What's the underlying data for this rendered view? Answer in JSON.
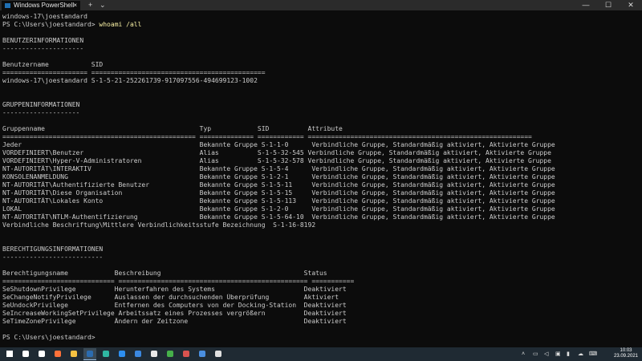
{
  "window": {
    "tab_title": "Windows PowerShell",
    "tab_close": "×",
    "new_tab": "+",
    "tab_dropdown": "⌄",
    "minimize": "—",
    "maximize": "☐",
    "close": "✕"
  },
  "terminal": {
    "lines": [
      "windows-17\\joestandard",
      "PS C:\\Users\\joestandard> ",
      "",
      "BENUTZERINFORMATIONEN",
      "---------------------",
      "",
      "Benutzername           SID",
      "====================== =============================================",
      "windows-17\\joestandard S-1-5-21-252261739-917097556-494699123-1002",
      "",
      "",
      "GRUPPENINFORMATIONEN",
      "--------------------",
      "",
      "Gruppenname                                        Typ            SID          Attribute",
      "================================================== ============== ============ ==========================================================",
      "Jeder                                              Bekannte Gruppe S-1-1-0      Verbindliche Gruppe, Standardmäßig aktiviert, Aktivierte Gruppe",
      "VORDEFINIERT\\Benutzer                              Alias          S-1-5-32-545 Verbindliche Gruppe, Standardmäßig aktiviert, Aktivierte Gruppe",
      "VORDEFINIERT\\Hyper-V-Administratoren               Alias          S-1-5-32-578 Verbindliche Gruppe, Standardmäßig aktiviert, Aktivierte Gruppe",
      "NT-AUTORITÄT\\INTERAKTIV                            Bekannte Gruppe S-1-5-4      Verbindliche Gruppe, Standardmäßig aktiviert, Aktivierte Gruppe",
      "KONSOLENANMELDUNG                                  Bekannte Gruppe S-1-2-1      Verbindliche Gruppe, Standardmäßig aktiviert, Aktivierte Gruppe",
      "NT-AUTORITÄT\\Authentifizierte Benutzer             Bekannte Gruppe S-1-5-11     Verbindliche Gruppe, Standardmäßig aktiviert, Aktivierte Gruppe",
      "NT-AUTORITÄT\\Diese Organisation                    Bekannte Gruppe S-1-5-15     Verbindliche Gruppe, Standardmäßig aktiviert, Aktivierte Gruppe",
      "NT-AUTORITÄT\\Lokales Konto                         Bekannte Gruppe S-1-5-113    Verbindliche Gruppe, Standardmäßig aktiviert, Aktivierte Gruppe",
      "LOKAL                                              Bekannte Gruppe S-1-2-0      Verbindliche Gruppe, Standardmäßig aktiviert, Aktivierte Gruppe",
      "NT-AUTORITÄT\\NTLM-Authentifizierung                Bekannte Gruppe S-1-5-64-10  Verbindliche Gruppe, Standardmäßig aktiviert, Aktivierte Gruppe",
      "Verbindliche Beschriftung\\Mittlere Verbindlichkeitsstufe Bezeichnung  S-1-16-8192",
      "",
      "",
      "BERECHTIGUNGSINFORMATIONEN",
      "--------------------------",
      "",
      "Berechtigungsname            Beschreibung                                     Status",
      "============================= ================================================= ===========",
      "SeShutdownPrivilege          Herunterfahren des Systems                       Deaktiviert",
      "SeChangeNotifyPrivilege      Auslassen der durchsuchenden Überprüfung         Aktiviert",
      "SeUndockPrivilege            Entfernen des Computers von der Docking-Station  Deaktiviert",
      "SeIncreaseWorkingSetPrivilege Arbeitssatz eines Prozesses vergrößern          Deaktiviert",
      "SeTimeZonePrivilege          Ändern der Zeitzone                              Deaktiviert",
      "",
      "PS C:\\Users\\joestandard> "
    ],
    "command_text": "whoami /all",
    "command_line_index": 1
  },
  "taskbar": {
    "apps": [
      {
        "name": "start-icon",
        "color": "#ffffff"
      },
      {
        "name": "search-icon",
        "color": "#ffffff"
      },
      {
        "name": "task-view-icon",
        "color": "#ffffff"
      },
      {
        "name": "firefox-icon",
        "color": "#ff7139"
      },
      {
        "name": "file-explorer-icon",
        "color": "#f5c242"
      },
      {
        "name": "powershell-icon",
        "color": "#2b6cb0"
      },
      {
        "name": "edge-icon",
        "color": "#2fb7a3"
      },
      {
        "name": "store-icon",
        "color": "#2d8ff0"
      },
      {
        "name": "mail-icon",
        "color": "#3b88e0"
      },
      {
        "name": "sharex-icon",
        "color": "#e8e8e8"
      },
      {
        "name": "app-icon-green",
        "color": "#46b04a"
      },
      {
        "name": "app-icon-red",
        "color": "#d9534f"
      },
      {
        "name": "app-icon-blue",
        "color": "#4a8fe0"
      },
      {
        "name": "settings-icon",
        "color": "#e0e0e0"
      }
    ],
    "active_app": "powershell-icon",
    "clock_time": "10:03",
    "clock_date": "23.09.2021"
  },
  "colors": {
    "terminal_bg": "#0c0c0c",
    "terminal_fg": "#cccccc",
    "command": "#f9f1a5",
    "taskbar_bg": "#1f2a33"
  }
}
